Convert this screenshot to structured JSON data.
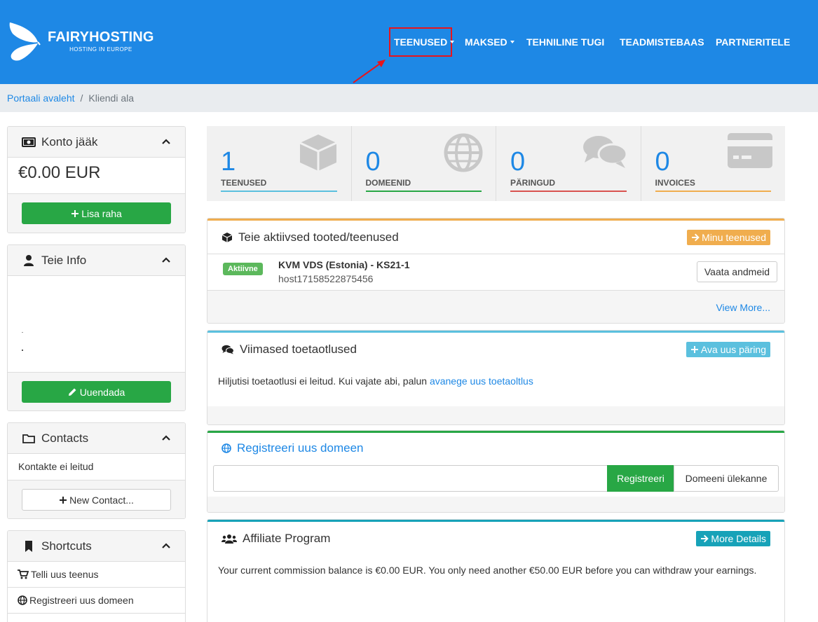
{
  "brand": {
    "name": "FAIRYHOSTING",
    "tagline": "HOSTING IN EUROPE",
    "color": "#1e88e5"
  },
  "nav": [
    {
      "label": "TEENUSED",
      "dropdown": true,
      "highlighted": true
    },
    {
      "label": "MAKSED",
      "dropdown": true
    },
    {
      "label": "TEHNILINE TUGI",
      "dropdown": false
    },
    {
      "label": "TEADMISTEBAAS",
      "dropdown": false
    },
    {
      "label": "PARTNERITELE",
      "dropdown": false
    }
  ],
  "breadcrumb": {
    "home": "Portaali avaleht",
    "separator": "/",
    "current": "Kliendi ala"
  },
  "sidebar": {
    "balance": {
      "title": "Konto jääk",
      "amount": "€0.00 EUR",
      "button": "Lisa raha"
    },
    "info": {
      "title": "Teie Info",
      "button": "Uuendada"
    },
    "contacts": {
      "title": "Contacts",
      "empty": "Kontakte ei leitud",
      "button": "New Contact..."
    },
    "shortcuts": {
      "title": "Shortcuts",
      "items": [
        "Telli uus teenus",
        "Registreeri uus domeen"
      ]
    }
  },
  "stats": [
    {
      "value": "1",
      "label": "TEENUSED",
      "color": "#5bc0de",
      "icon": "cube-icon"
    },
    {
      "value": "0",
      "label": "DOMEENID",
      "color": "#28a745",
      "icon": "globe-icon"
    },
    {
      "value": "0",
      "label": "PÄRINGUD",
      "color": "#d9534f",
      "icon": "comments-icon"
    },
    {
      "value": "0",
      "label": "INVOICES",
      "color": "#f0ad4e",
      "icon": "credit-card-icon"
    }
  ],
  "products": {
    "title": "Teie aktiivsed tooted/teenused",
    "button": "Minu teenused",
    "accent": "#f0ad4e",
    "service": {
      "status": "Aktiivne",
      "name": "KVM VDS (Estonia) - KS21-1",
      "host": "host17158522875456",
      "button": "Vaata andmeid"
    },
    "footer_link": "View More..."
  },
  "tickets": {
    "title": "Viimased toetaotlused",
    "button": "Ava uus päring",
    "accent": "#5bc0de",
    "text": "Hiljutisi toetaotlusi ei leitud. Kui vajate abi, palun",
    "link": "avanege uus toetaoltlus"
  },
  "domain": {
    "title": "Registreeri uus domeen",
    "accent": "#28a745",
    "register_button": "Registreeri",
    "transfer_button": "Domeeni ülekanne"
  },
  "affiliate": {
    "title": "Affiliate Program",
    "button": "More Details",
    "accent": "#17a2b8",
    "text": "Your current commission balance is €0.00 EUR. You only need another €50.00 EUR before you can withdraw your earnings."
  }
}
